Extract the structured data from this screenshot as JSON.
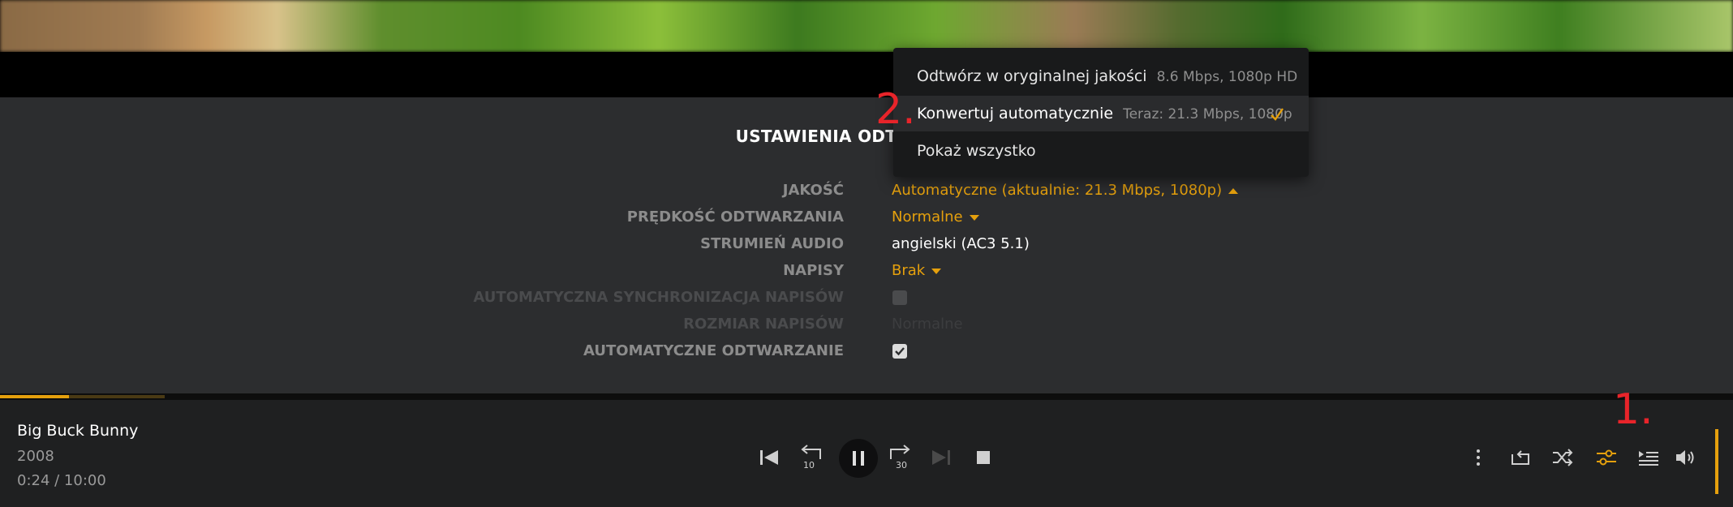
{
  "colors": {
    "accent": "#e5a00d",
    "annotation": "#e8242a",
    "panel_bg": "#2c2d2f",
    "bar_bg": "#1f2021"
  },
  "settings": {
    "title": "USTAWIENIA ODTWARZANIA",
    "quality_label": "JAKOŚĆ",
    "quality_value": "Automatyczne (aktualnie: 21.3 Mbps, 1080p)",
    "speed_label": "PRĘDKOŚĆ ODTWARZANIA",
    "speed_value": "Normalne",
    "audio_label": "STRUMIEŃ AUDIO",
    "audio_value": "angielski (AC3 5.1)",
    "subs_label": "NAPISY",
    "subs_value": "Brak",
    "subsync_label": "AUTOMATYCZNA SYNCHRONIZACJA NAPISÓW",
    "subsync_checked": false,
    "subsize_label": "ROZMIAR NAPISÓW",
    "subsize_value": "Normalne",
    "autoplay_label": "AUTOMATYCZNE ODTWARZANIE",
    "autoplay_checked": true
  },
  "quality_menu": {
    "items": [
      {
        "label": "Odtwórz w oryginalnej jakości",
        "sub": "8.6 Mbps, 1080p HD",
        "selected": false
      },
      {
        "label": "Konwertuj automatycznie",
        "sub": "Teraz: 21.3 Mbps, 1080p",
        "selected": true
      },
      {
        "label": "Pokaż wszystko",
        "sub": "",
        "selected": false
      }
    ]
  },
  "player": {
    "title": "Big Buck Bunny",
    "year": "2008",
    "time": "0:24 / 10:00",
    "progress_fraction": 0.04,
    "buffered_fraction": 0.095,
    "rewind_label": "10",
    "forward_label": "30"
  },
  "annotations": {
    "one": "1.",
    "two": "2."
  },
  "icons": [
    "skip-previous-icon",
    "rewind-10-icon",
    "pause-icon",
    "forward-30-icon",
    "skip-next-icon",
    "stop-icon",
    "more-vertical-icon",
    "repeat-icon",
    "shuffle-icon",
    "settings-sliders-icon",
    "playlist-icon",
    "volume-icon",
    "checkmark-icon"
  ]
}
